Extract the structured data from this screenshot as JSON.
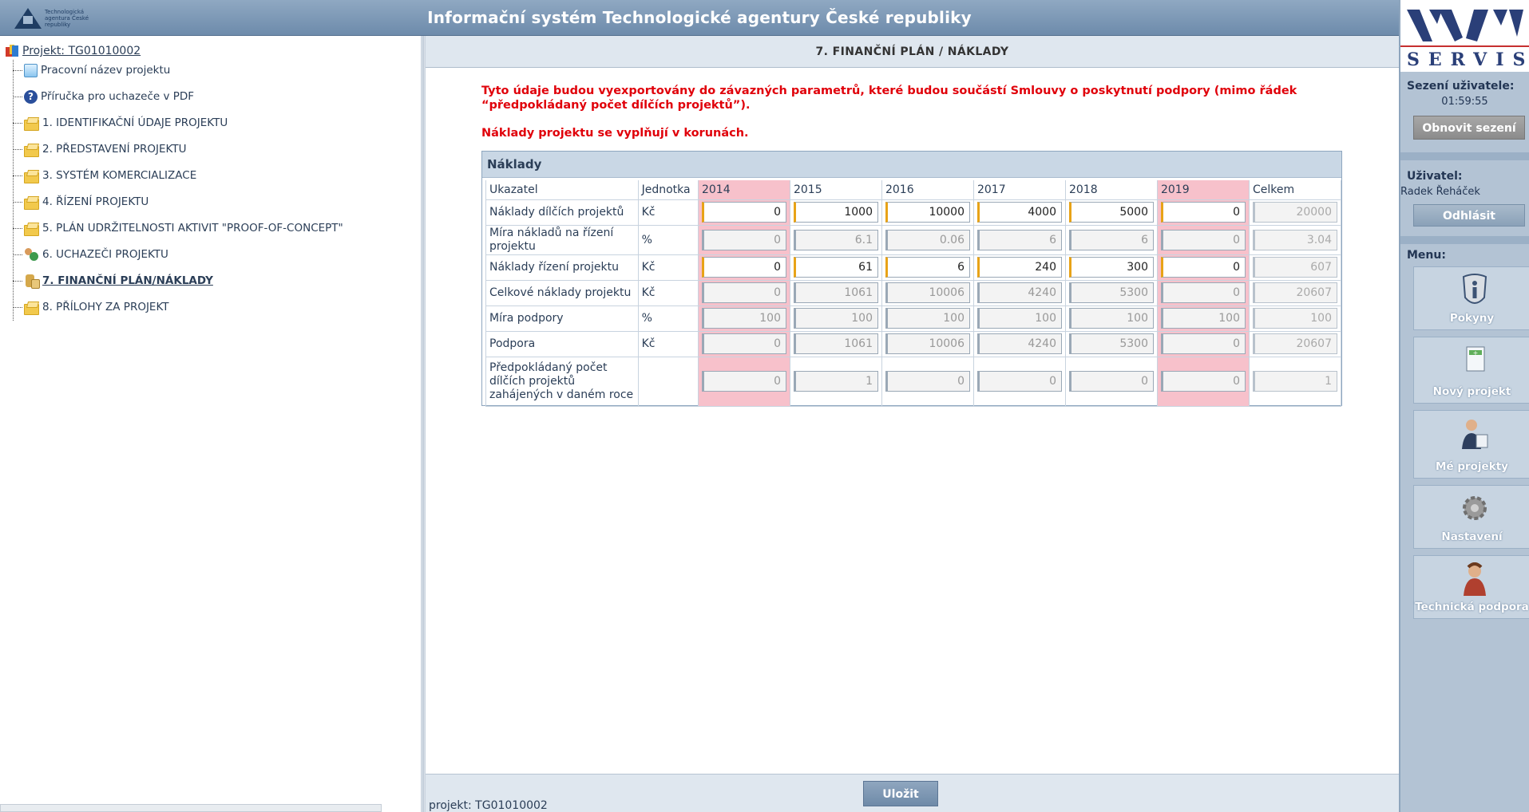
{
  "header": {
    "title": "Informační systém Technologické agentury České republiky",
    "logo_text": "Technologická agentura České republiky"
  },
  "tree": {
    "root": "Projekt: TG01010002",
    "items": [
      {
        "label": "Pracovní název projektu",
        "icon": "document-icon"
      },
      {
        "label": "Příručka pro uchazeče v PDF",
        "icon": "help-icon"
      },
      {
        "label": "1. IDENTIFIKAČNÍ ÚDAJE PROJEKTU",
        "icon": "folder-icon"
      },
      {
        "label": "2. PŘEDSTAVENÍ PROJEKTU",
        "icon": "folder-icon"
      },
      {
        "label": "3. SYSTÉM KOMERCIALIZACE",
        "icon": "folder-icon"
      },
      {
        "label": "4. ŘÍZENÍ PROJEKTU",
        "icon": "folder-icon"
      },
      {
        "label": "5. PLÁN UDRŽITELNOSTI AKTIVIT \"PROOF-OF-CONCEPT\"",
        "icon": "folder-icon"
      },
      {
        "label": "6. UCHAZEČI PROJEKTU",
        "icon": "people-icon"
      },
      {
        "label": "7. FINANČNÍ PLÁN/NÁKLADY",
        "icon": "money-icon",
        "active": true
      },
      {
        "label": "8. PŘÍLOHY ZA PROJEKT",
        "icon": "folder-icon"
      }
    ]
  },
  "main": {
    "heading": "7. FINANČNÍ PLÁN / NÁKLADY",
    "notice": "Tyto údaje budou vyexportovány do závazných parametrů, které budou součástí Smlouvy o poskytnutí podpory (mimo řádek “předpokládaný počet dílčích projektů”).",
    "notice2": "Náklady projektu se vyplňují v korunách.",
    "panel_title": "Náklady",
    "columns": {
      "indicator": "Ukazatel",
      "unit": "Jednotka",
      "years": [
        "2014",
        "2015",
        "2016",
        "2017",
        "2018",
        "2019"
      ],
      "total": "Celkem"
    },
    "rows": [
      {
        "label": "Náklady dílčích projektů",
        "unit": "Kč",
        "values": [
          "0",
          "1000",
          "10000",
          "4000",
          "5000",
          "0"
        ],
        "total": "20000",
        "editable": true
      },
      {
        "label": "Míra nákladů na řízení projektu",
        "unit": "%",
        "values": [
          "0",
          "6.1",
          "0.06",
          "6",
          "6",
          "0"
        ],
        "total": "3.04",
        "editable": false
      },
      {
        "label": "Náklady řízení projektu",
        "unit": "Kč",
        "values": [
          "0",
          "61",
          "6",
          "240",
          "300",
          "0"
        ],
        "total": "607",
        "editable": true
      },
      {
        "label": "Celkové náklady projektu",
        "unit": "Kč",
        "values": [
          "0",
          "1061",
          "10006",
          "4240",
          "5300",
          "0"
        ],
        "total": "20607",
        "editable": false
      },
      {
        "label": "Míra podpory",
        "unit": "%",
        "values": [
          "100",
          "100",
          "100",
          "100",
          "100",
          "100"
        ],
        "total": "100",
        "editable": false
      },
      {
        "label": "Podpora",
        "unit": "Kč",
        "values": [
          "0",
          "1061",
          "10006",
          "4240",
          "5300",
          "0"
        ],
        "total": "20607",
        "editable": false
      },
      {
        "label": "Předpokládaný počet dílčích projektů zahájených v daném roce",
        "unit": "",
        "values": [
          "0",
          "1",
          "0",
          "0",
          "0",
          "0"
        ],
        "total": "1",
        "editable": false
      }
    ],
    "save_label": "Uložit",
    "footer_text": "projekt: TG01010002"
  },
  "sidebar": {
    "brand": "SERVIS",
    "session_label": "Sezení uživatele:",
    "session_time": "01:59:55",
    "refresh_label": "Obnovit sezení",
    "user_label": "Uživatel:",
    "user_name": "Radek Řeháček",
    "logout_label": "Odhlásit",
    "menu_label": "Menu:",
    "menu": [
      {
        "label": "Pokyny",
        "icon": "info-shield-icon"
      },
      {
        "label": "Nový projekt",
        "icon": "new-document-icon"
      },
      {
        "label": "Mé projekty",
        "icon": "user-projects-icon"
      },
      {
        "label": "Nastavení",
        "icon": "gear-icon"
      },
      {
        "label": "Technická podpora",
        "icon": "support-agent-icon"
      }
    ]
  },
  "colors": {
    "header": "#7b97b6",
    "notice": "#e0000a",
    "highlight_column": "#f7c1cb",
    "editable_marker": "#e8a317"
  }
}
